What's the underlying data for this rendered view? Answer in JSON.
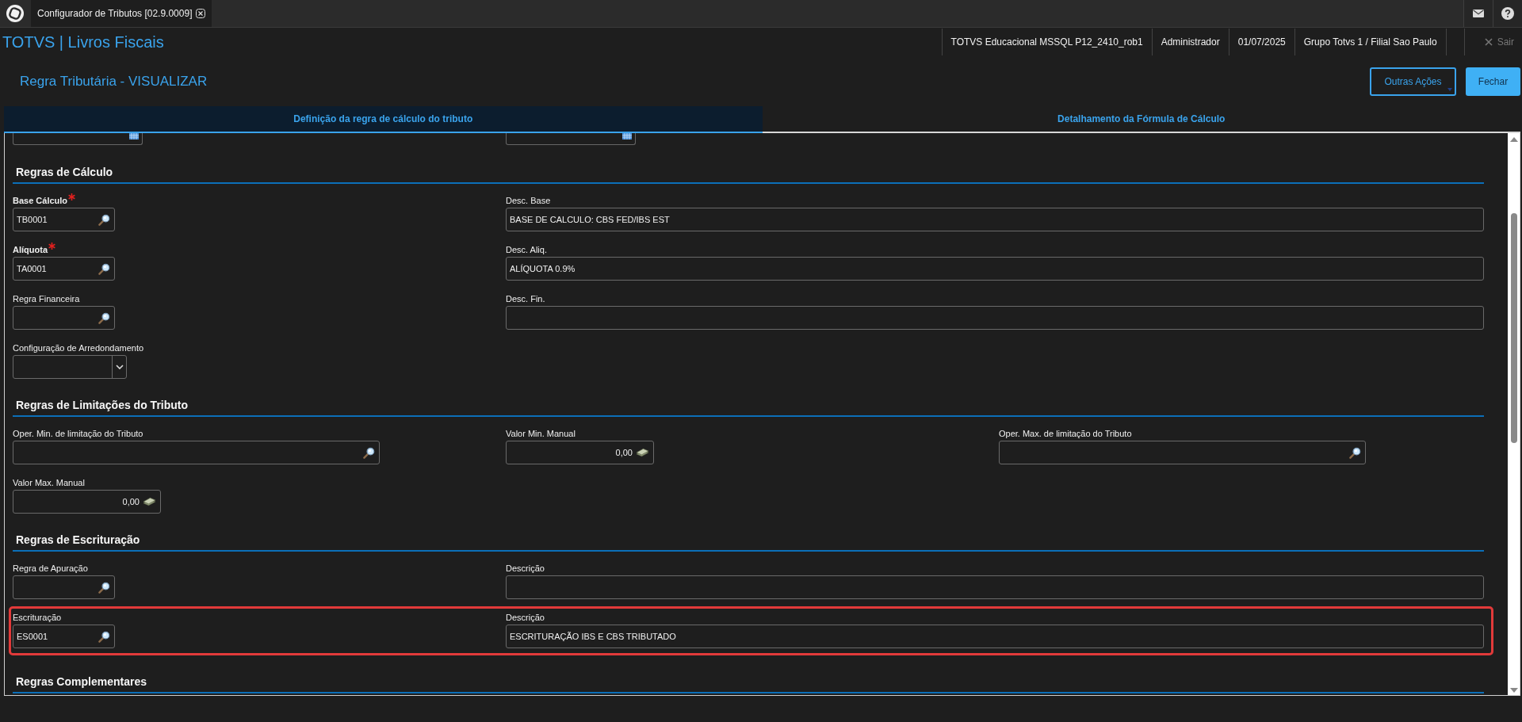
{
  "app_tab": {
    "title": "Configurador de Tributos [02.9.0009]"
  },
  "header": {
    "brand": "TOTVS | Livros Fiscais",
    "info": [
      "TOTVS Educacional MSSQL P12_2410_rob1",
      "Administrador",
      "01/07/2025",
      "Grupo Totvs 1 / Filial Sao Paulo"
    ],
    "logout": {
      "label": "Sair",
      "disabled": true
    }
  },
  "page": {
    "title": "Regra Tributária - VISUALIZAR",
    "buttons": [
      {
        "label": "Outras Ações",
        "kind": "menu"
      },
      {
        "label": "Fechar",
        "kind": "primary"
      }
    ]
  },
  "tabs": [
    {
      "label": "Definição da regra de cálculo do tributo",
      "selected": true
    },
    {
      "label": "Detalhamento da Fórmula de Cálculo",
      "selected": false
    }
  ],
  "sections": [
    {
      "title": "Regras de Cálculo",
      "rows": [
        {
          "highlighted": false,
          "fields": [
            {
              "kind": "code",
              "label": "Base Cálculo",
              "required": true,
              "value": "TB0001"
            },
            {
              "kind": "text",
              "label": "Desc. Base",
              "required": false,
              "value": "BASE DE CALCULO: CBS FED/IBS EST"
            }
          ]
        },
        {
          "highlighted": false,
          "fields": [
            {
              "kind": "code",
              "label": "Alíquota",
              "required": true,
              "value": "TA0001"
            },
            {
              "kind": "text",
              "label": "Desc. Aliq.",
              "required": false,
              "value": "ALÍQUOTA 0.9%"
            }
          ]
        },
        {
          "highlighted": false,
          "fields": [
            {
              "kind": "code",
              "label": "Regra Financeira",
              "required": false
            },
            {
              "kind": "text",
              "label": "Desc. Fin.",
              "required": false
            }
          ]
        },
        {
          "highlighted": false,
          "fields": [
            {
              "kind": "select",
              "label": "Configuração de Arredondamento",
              "required": false
            }
          ]
        }
      ]
    },
    {
      "title": "Regras de Limitações do Tributo",
      "rows": [
        {
          "highlighted": false,
          "fields": [
            {
              "kind": "search",
              "label": "Oper. Min. de limitação do Tributo",
              "required": false
            },
            {
              "kind": "money",
              "label": "Valor Min. Manual",
              "required": false,
              "value": "0,00"
            },
            {
              "kind": "search",
              "label": "Oper. Max. de limitação do Tributo",
              "required": false
            }
          ]
        },
        {
          "highlighted": false,
          "fields": [
            {
              "kind": "money",
              "label": "Valor Max. Manual",
              "required": false,
              "value": "0,00"
            }
          ]
        }
      ]
    },
    {
      "title": "Regras de Escrituração",
      "rows": [
        {
          "highlighted": false,
          "fields": [
            {
              "kind": "code",
              "label": "Regra de Apuração",
              "required": false
            },
            {
              "kind": "text",
              "label": "Descrição",
              "required": false
            }
          ]
        },
        {
          "highlighted": true,
          "fields": [
            {
              "kind": "code",
              "label": "Escrituração",
              "required": false,
              "value": "ES0001"
            },
            {
              "kind": "text",
              "label": "Descrição",
              "required": false,
              "value": "ESCRITURAÇÃO IBS E CBS TRIBUTADO"
            }
          ]
        }
      ]
    },
    {
      "title": "Regras Complementares"
    }
  ]
}
